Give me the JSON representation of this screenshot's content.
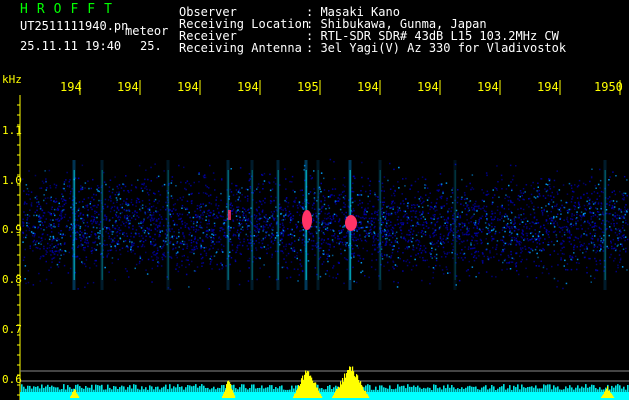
{
  "app": {
    "title": "HROFFT",
    "filename": "UT2511111940.pn",
    "mode": "meteor",
    "datetime": "25.11.11 19:40",
    "frame": "25."
  },
  "header": {
    "rows": [
      {
        "label": "Observer",
        "value": ": Masaki Kano"
      },
      {
        "label": "Receiving Location",
        "value": ": Shibukawa, Gunma, Japan"
      },
      {
        "label": "Receiver",
        "value": ": RTL-SDR SDR# 43dB L15 103.2MHz CW"
      },
      {
        "label": "Receiving Antenna",
        "value": ": 3el Yagi(V) Az 330 for Vladivostok"
      }
    ]
  },
  "x_axis": {
    "ticks": [
      "194",
      "194",
      "194",
      "194",
      "195",
      "194",
      "194",
      "194",
      "194",
      "1950"
    ]
  },
  "y_axis": {
    "unit": "kHz",
    "ticks": [
      "1.1",
      "1.0",
      "0.9",
      "0.8",
      "0.7",
      "0.6"
    ]
  },
  "colors": {
    "text_header": "#ffffff",
    "text_axis": "#ffff00",
    "title": "#00ff00",
    "noise_low": "#0000aa",
    "noise_mid": "#00a0ff",
    "echo_hot": "#ff3366",
    "signal_line": "#ffff00",
    "baseline": "#00ffff"
  }
}
